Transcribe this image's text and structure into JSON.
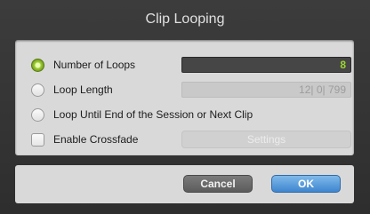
{
  "window": {
    "title": "Clip Looping"
  },
  "options": {
    "number_of_loops": {
      "label": "Number of Loops",
      "value": "8",
      "selected": true
    },
    "loop_length": {
      "label": "Loop Length",
      "value": "12| 0| 799",
      "selected": false
    },
    "loop_until_end": {
      "label": "Loop Until End of the Session or Next Clip",
      "selected": false
    },
    "enable_crossfade": {
      "label": "Enable Crossfade",
      "checked": false,
      "settings_label": "Settings"
    }
  },
  "buttons": {
    "cancel": "Cancel",
    "ok": "OK"
  },
  "colors": {
    "accent_green": "#9bd630",
    "ok_blue": "#3f86cf"
  }
}
